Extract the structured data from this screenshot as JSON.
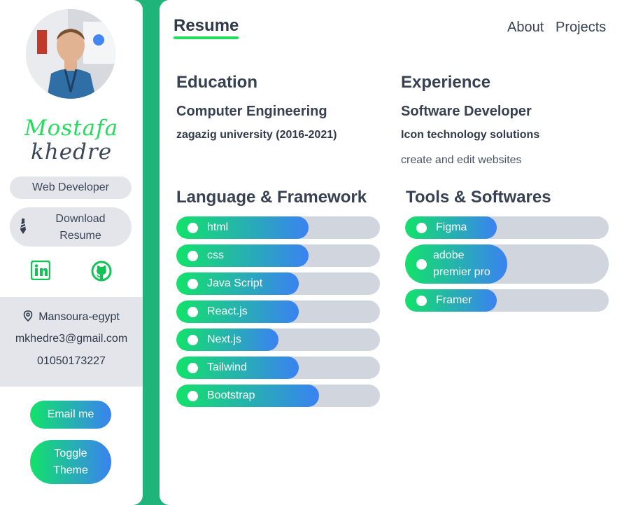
{
  "profile": {
    "first_name": "Mostafa",
    "last_name": "khedre",
    "role": "Web Developer",
    "download_label": "Download Resume",
    "location": "Mansoura-egypt",
    "email": "mkhedre3@gmail.com",
    "phone": "01050173227",
    "email_button": "Email me",
    "toggle_button": "Toggle Theme"
  },
  "nav": {
    "active_tab": "Resume",
    "about": "About",
    "projects": "Projects"
  },
  "education": {
    "title": "Education",
    "degree": "Computer Engineering",
    "school": "zagazig university (2016-2021)"
  },
  "experience": {
    "title": "Experience",
    "position": "Software Developer",
    "company": "Icon technology solutions",
    "description": "create and edit websites"
  },
  "languages": {
    "title": "Language & Framework",
    "items": [
      {
        "label": "html",
        "level": 0.65
      },
      {
        "label": "css",
        "level": 0.65
      },
      {
        "label": "Java Script",
        "level": 0.6
      },
      {
        "label": "React.js",
        "level": 0.6
      },
      {
        "label": "Next.js",
        "level": 0.5
      },
      {
        "label": "Tailwind",
        "level": 0.6
      },
      {
        "label": "Bootstrap",
        "level": 0.7
      }
    ]
  },
  "tools": {
    "title": "Tools & Softwares",
    "items": [
      {
        "label": "Figma",
        "level": 0.45
      },
      {
        "label": "adobe premier pro",
        "level": 0.5
      },
      {
        "label": "Framer",
        "level": 0.45
      }
    ]
  },
  "colors": {
    "accent_green": "#22dc5c",
    "gradient_start": "#12e26a",
    "gradient_end": "#3a82f2",
    "background": "#1fb47a"
  }
}
